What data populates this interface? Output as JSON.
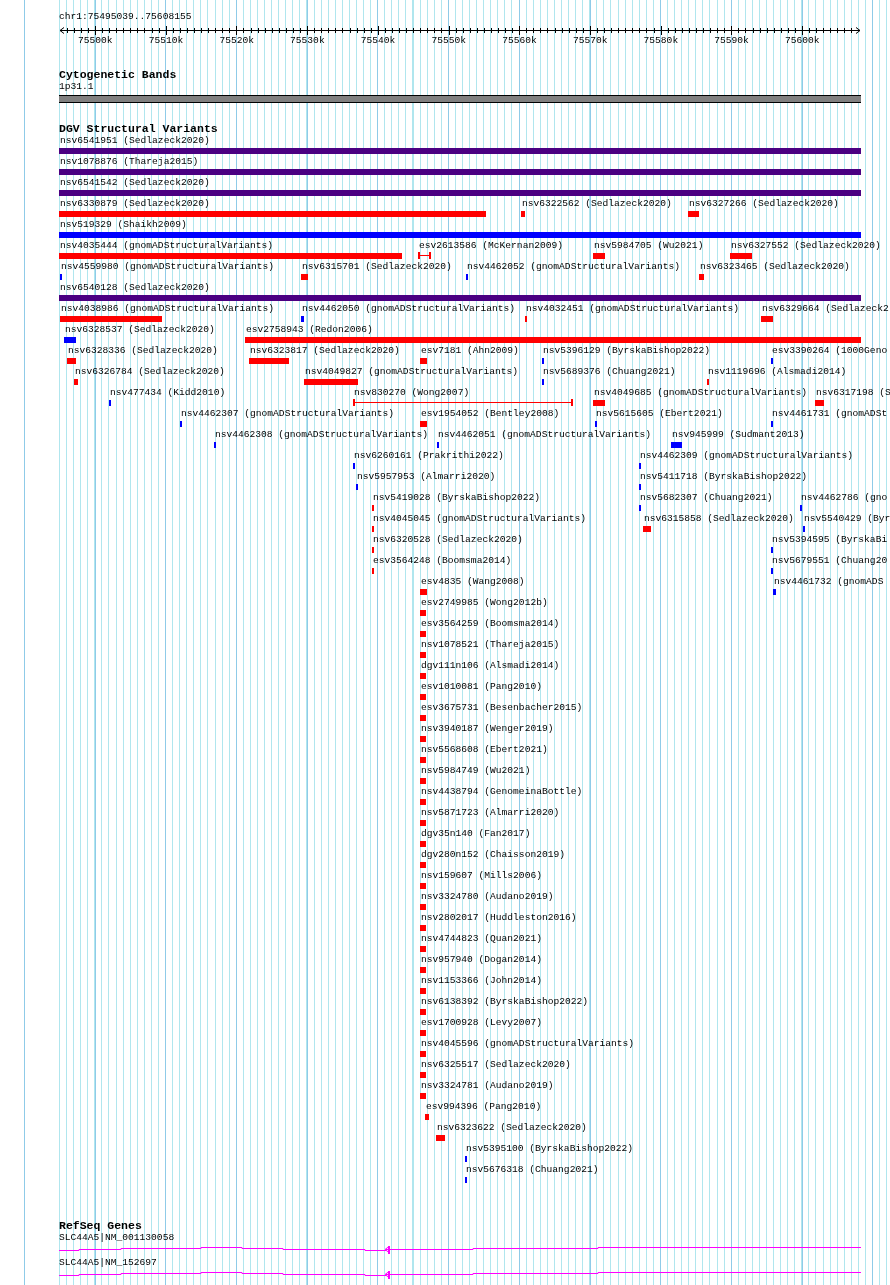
{
  "location": "chr1:75495039..75608155",
  "ruler": {
    "ticks": [
      "75500k",
      "75510k",
      "75520k",
      "75530k",
      "75540k",
      "75550k",
      "75560k",
      "75570k",
      "75580k",
      "75590k",
      "75600k"
    ]
  },
  "cytogenetic_bands": {
    "title": "Cytogenetic Bands",
    "bands": [
      {
        "label": "1p31.1"
      }
    ]
  },
  "dgv_structural_variants": {
    "title": "DGV Structural Variants",
    "features": [
      {
        "label": "nsv6541951 (Sedlazeck2020)",
        "color": "#4b0082",
        "kind": "bar"
      },
      {
        "label": "nsv1078876 (Thareja2015)",
        "color": "#4b0082",
        "kind": "bar"
      },
      {
        "label": "nsv6541542 (Sedlazeck2020)",
        "color": "#4b0082",
        "kind": "bar"
      },
      {
        "label": "nsv6330879 (Sedlazeck2020)",
        "color": "#ff0000",
        "kind": "bar"
      },
      {
        "label": "nsv6322562 (Sedlazeck2020)",
        "color": "#ff0000",
        "kind": "bar"
      },
      {
        "label": "nsv6327266 (Sedlazeck2020)",
        "color": "#ff0000",
        "kind": "bar"
      },
      {
        "label": "nsv519329 (Shaikh2009)",
        "color": "#0000ff",
        "kind": "bar"
      },
      {
        "label": "nsv4035444 (gnomADStructuralVariants)",
        "color": "#ff0000",
        "kind": "bar"
      },
      {
        "label": "esv2613586 (McKernan2009)",
        "color": "#ff0000",
        "kind": "interval"
      },
      {
        "label": "nsv5984705 (Wu2021)",
        "color": "#ff0000",
        "kind": "bar"
      },
      {
        "label": "nsv6327552 (Sedlazeck2020)",
        "color": "#ff0000",
        "kind": "bar"
      },
      {
        "label": "nsv4559980 (gnomADStructuralVariants)",
        "color": "#0000ff",
        "kind": "bar"
      },
      {
        "label": "nsv6315701 (Sedlazeck2020)",
        "color": "#ff0000",
        "kind": "bar"
      },
      {
        "label": "nsv4462052 (gnomADStructuralVariants)",
        "color": "#0000ff",
        "kind": "bar"
      },
      {
        "label": "nsv6323465 (Sedlazeck2020)",
        "color": "#ff0000",
        "kind": "bar"
      },
      {
        "label": "nsv6540128 (Sedlazeck2020)",
        "color": "#4b0082",
        "kind": "bar"
      },
      {
        "label": "nsv4038986 (gnomADStructuralVariants)",
        "color": "#ff0000",
        "kind": "bar"
      },
      {
        "label": "nsv4462050 (gnomADStructuralVariants)",
        "color": "#0000ff",
        "kind": "bar"
      },
      {
        "label": "nsv4032451 (gnomADStructuralVariants)",
        "color": "#ff0000",
        "kind": "bar"
      },
      {
        "label": "nsv6329664 (Sedlazeck2",
        "color": "#ff0000",
        "kind": "bar"
      },
      {
        "label": "nsv6328537 (Sedlazeck2020)",
        "color": "#0000ff",
        "kind": "bar"
      },
      {
        "label": "esv2758943 (Redon2006)",
        "color": "#ff0000",
        "kind": "bar"
      },
      {
        "label": "nsv6328336 (Sedlazeck2020)",
        "color": "#ff0000",
        "kind": "bar"
      },
      {
        "label": "nsv6323817 (Sedlazeck2020)",
        "color": "#ff0000",
        "kind": "bar"
      },
      {
        "label": "esv7181 (Ahn2009)",
        "color": "#ff0000",
        "kind": "bar"
      },
      {
        "label": "nsv5396129 (ByrskaBishop2022)",
        "color": "#0000ff",
        "kind": "bar"
      },
      {
        "label": "esv3390264 (1000Geno",
        "color": "#0000ff",
        "kind": "bar"
      },
      {
        "label": "nsv6326784 (Sedlazeck2020)",
        "color": "#ff0000",
        "kind": "bar"
      },
      {
        "label": "nsv4049827 (gnomADStructuralVariants)",
        "color": "#ff0000",
        "kind": "bar"
      },
      {
        "label": "nsv5689376 (Chuang2021)",
        "color": "#0000ff",
        "kind": "bar"
      },
      {
        "label": "nsv1119696 (Alsmadi2014)",
        "color": "#ff0000",
        "kind": "bar"
      },
      {
        "label": "nsv477434 (Kidd2010)",
        "color": "#0000ff",
        "kind": "bar"
      },
      {
        "label": "nsv830270 (Wong2007)",
        "color": "#ff0000",
        "kind": "interval"
      },
      {
        "label": "nsv4049685 (gnomADStructuralVariants)",
        "color": "#ff0000",
        "kind": "bar"
      },
      {
        "label": "nsv6317198 (S",
        "color": "#ff0000",
        "kind": "bar"
      },
      {
        "label": "nsv4462307 (gnomADStructuralVariants)",
        "color": "#0000ff",
        "kind": "bar"
      },
      {
        "label": "esv1954052 (Bentley2008)",
        "color": "#ff0000",
        "kind": "bar"
      },
      {
        "label": "nsv5615605 (Ebert2021)",
        "color": "#0000ff",
        "kind": "bar"
      },
      {
        "label": "nsv4461731 (gnomADSt",
        "color": "#0000ff",
        "kind": "bar"
      },
      {
        "label": "nsv4462308 (gnomADStructuralVariants)",
        "color": "#0000ff",
        "kind": "bar"
      },
      {
        "label": "nsv4462051 (gnomADStructuralVariants)",
        "color": "#0000ff",
        "kind": "bar"
      },
      {
        "label": "nsv945999 (Sudmant2013)",
        "color": "#0000ff",
        "kind": "bar"
      },
      {
        "label": "nsv6260161 (Prakrithi2022)",
        "color": "#0000ff",
        "kind": "bar"
      },
      {
        "label": "nsv4462309 (gnomADStructuralVariants)",
        "color": "#0000ff",
        "kind": "bar"
      },
      {
        "label": "nsv5957953 (Almarri2020)",
        "color": "#0000ff",
        "kind": "bar"
      },
      {
        "label": "nsv5411718 (ByrskaBishop2022)",
        "color": "#0000ff",
        "kind": "bar"
      },
      {
        "label": "nsv5419028 (ByrskaBishop2022)",
        "color": "#ff0000",
        "kind": "bar"
      },
      {
        "label": "nsv5682307 (Chuang2021)",
        "color": "#0000ff",
        "kind": "bar"
      },
      {
        "label": "nsv4462786 (gno",
        "color": "#0000ff",
        "kind": "bar"
      },
      {
        "label": "nsv4045045 (gnomADStructuralVariants)",
        "color": "#ff0000",
        "kind": "bar"
      },
      {
        "label": "nsv6315858 (Sedlazeck2020)",
        "color": "#ff0000",
        "kind": "bar"
      },
      {
        "label": "nsv5540429 (Byr",
        "color": "#0000ff",
        "kind": "bar"
      },
      {
        "label": "nsv6320528 (Sedlazeck2020)",
        "color": "#ff0000",
        "kind": "bar"
      },
      {
        "label": "nsv5394595 (ByrskaBi",
        "color": "#0000ff",
        "kind": "bar"
      },
      {
        "label": "esv3564248 (Boomsma2014)",
        "color": "#ff0000",
        "kind": "bar"
      },
      {
        "label": "nsv5679551 (Chuang20",
        "color": "#0000ff",
        "kind": "bar"
      },
      {
        "label": "esv4835 (Wang2008)",
        "color": "#ff0000",
        "kind": "bar"
      },
      {
        "label": "nsv4461732 (gnomADS",
        "color": "#0000ff",
        "kind": "bar"
      },
      {
        "label": "esv2749985 (Wong2012b)",
        "color": "#ff0000",
        "kind": "bar"
      },
      {
        "label": "esv3564259 (Boomsma2014)",
        "color": "#ff0000",
        "kind": "bar"
      },
      {
        "label": "nsv1078521 (Thareja2015)",
        "color": "#ff0000",
        "kind": "bar"
      },
      {
        "label": "dgv111n106 (Alsmadi2014)",
        "color": "#ff0000",
        "kind": "bar"
      },
      {
        "label": "esv1010081 (Pang2010)",
        "color": "#ff0000",
        "kind": "bar"
      },
      {
        "label": "esv3675731 (Besenbacher2015)",
        "color": "#ff0000",
        "kind": "bar"
      },
      {
        "label": "nsv3940187 (Wenger2019)",
        "color": "#ff0000",
        "kind": "bar"
      },
      {
        "label": "nsv5568608 (Ebert2021)",
        "color": "#ff0000",
        "kind": "bar"
      },
      {
        "label": "nsv5984749 (Wu2021)",
        "color": "#ff0000",
        "kind": "bar"
      },
      {
        "label": "nsv4438794 (GenomeinaBottle)",
        "color": "#ff0000",
        "kind": "bar"
      },
      {
        "label": "nsv5871723 (Almarri2020)",
        "color": "#ff0000",
        "kind": "bar"
      },
      {
        "label": "dgv35n140 (Fan2017)",
        "color": "#ff0000",
        "kind": "bar"
      },
      {
        "label": "dgv280n152 (Chaisson2019)",
        "color": "#ff0000",
        "kind": "bar"
      },
      {
        "label": "nsv159607 (Mills2006)",
        "color": "#ff0000",
        "kind": "bar"
      },
      {
        "label": "nsv3324780 (Audano2019)",
        "color": "#ff0000",
        "kind": "bar"
      },
      {
        "label": "nsv2802017 (Huddleston2016)",
        "color": "#ff0000",
        "kind": "bar"
      },
      {
        "label": "nsv4744823 (Quan2021)",
        "color": "#ff0000",
        "kind": "bar"
      },
      {
        "label": "nsv957940 (Dogan2014)",
        "color": "#ff0000",
        "kind": "bar"
      },
      {
        "label": "nsv1153366 (John2014)",
        "color": "#ff0000",
        "kind": "bar"
      },
      {
        "label": "nsv6138392 (ByrskaBishop2022)",
        "color": "#ff0000",
        "kind": "bar"
      },
      {
        "label": "esv1700928 (Levy2007)",
        "color": "#ff0000",
        "kind": "bar"
      },
      {
        "label": "nsv4045596 (gnomADStructuralVariants)",
        "color": "#ff0000",
        "kind": "bar"
      },
      {
        "label": "nsv6325517 (Sedlazeck2020)",
        "color": "#ff0000",
        "kind": "bar"
      },
      {
        "label": "nsv3324781 (Audano2019)",
        "color": "#ff0000",
        "kind": "bar"
      },
      {
        "label": "esv994396 (Pang2010)",
        "color": "#ff0000",
        "kind": "bar"
      },
      {
        "label": "nsv6323622 (Sedlazeck2020)",
        "color": "#ff0000",
        "kind": "bar"
      },
      {
        "label": "nsv5395100 (ByrskaBishop2022)",
        "color": "#0000ff",
        "kind": "bar"
      },
      {
        "label": "nsv5676318 (Chuang2021)",
        "color": "#0000ff",
        "kind": "bar"
      }
    ]
  },
  "refseq_genes": {
    "title": "RefSeq Genes",
    "transcripts": [
      {
        "label": "SLC44A5|NM_001130058"
      },
      {
        "label": "SLC44A5|NM_152697"
      }
    ]
  }
}
